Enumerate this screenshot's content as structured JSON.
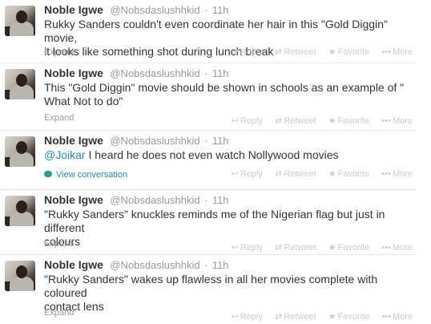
{
  "tweets": [
    {
      "name": "Noble Igwe",
      "handle": "@Nobsdaslushhkid",
      "sep": "·",
      "time": "11h",
      "text_line1": "Rukky Sanders couldn't even coordinate her hair in this \"Gold Diggin\" movie,",
      "text_line2": "it looks like something shot during lunch break",
      "expand": "Expand"
    },
    {
      "name": "Noble Igwe",
      "handle": "@Nobsdaslushhkid",
      "sep": "·",
      "time": "11h",
      "text_line1": "This \"Gold Diggin\" movie should be shown in schools as an example of \"",
      "text_line2": "What Not to do\"",
      "expand": "Expand"
    },
    {
      "name": "Noble Igwe",
      "handle": "@Nobsdaslushhkid",
      "sep": "·",
      "time": "11h",
      "mention": "@Joikar",
      "text_rest": " I heard he does not even watch Nollywood movies",
      "conversation": "View conversation"
    },
    {
      "name": "Noble Igwe",
      "handle": "@Nobsdaslushhkid",
      "sep": "·",
      "time": "11h",
      "text_line1": "\"Rukky Sanders\" knuckles reminds me of the Nigerian flag but just in different",
      "text_line2": "colours",
      "expand": "Expand"
    },
    {
      "name": "Noble Igwe",
      "handle": "@Nobsdaslushhkid",
      "sep": "·",
      "time": "11h",
      "text_line1": "\"Rukky Sanders\" wakes up flawless in all her movies complete with coloured",
      "text_line2": "contact lens",
      "expand": "Expand"
    }
  ],
  "actions": {
    "reply": "Reply",
    "retweet": "Retweet",
    "favorite": "Favorite",
    "more": "More"
  },
  "icons": {
    "reply": "reply-arrow-icon",
    "retweet": "retweet-icon",
    "favorite": "star-icon",
    "more": "ellipsis-icon",
    "conversation": "speech-bubble-icon"
  }
}
